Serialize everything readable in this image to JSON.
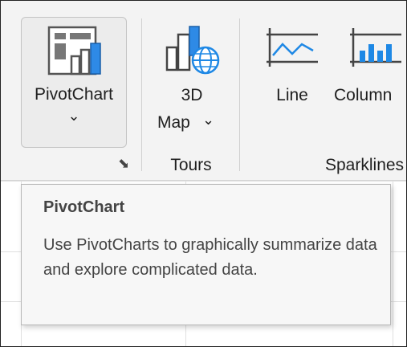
{
  "ribbon": {
    "pivotchart": {
      "label": "PivotChart",
      "icon": "pivotchart-icon",
      "dropdown": "⌄"
    },
    "map3d": {
      "label_line1": "3D",
      "label_line2": "Map",
      "dropdown": "⌄",
      "icon": "3d-map-icon"
    },
    "sparkline_line": {
      "label": "Line",
      "icon": "line-sparkline-icon"
    },
    "sparkline_column": {
      "label": "Column",
      "icon": "column-sparkline-icon"
    },
    "groups": {
      "tours": "Tours",
      "sparklines": "Sparklines"
    },
    "dialog_launcher": "⬊"
  },
  "tooltip": {
    "title": "PivotChart",
    "description": "Use PivotCharts to graphically summarize data and explore complicated data."
  },
  "colors": {
    "accent_blue": "#1e88e5",
    "ribbon_bg": "#f3f3f3",
    "tooltip_bg": "#f7f7f7"
  }
}
